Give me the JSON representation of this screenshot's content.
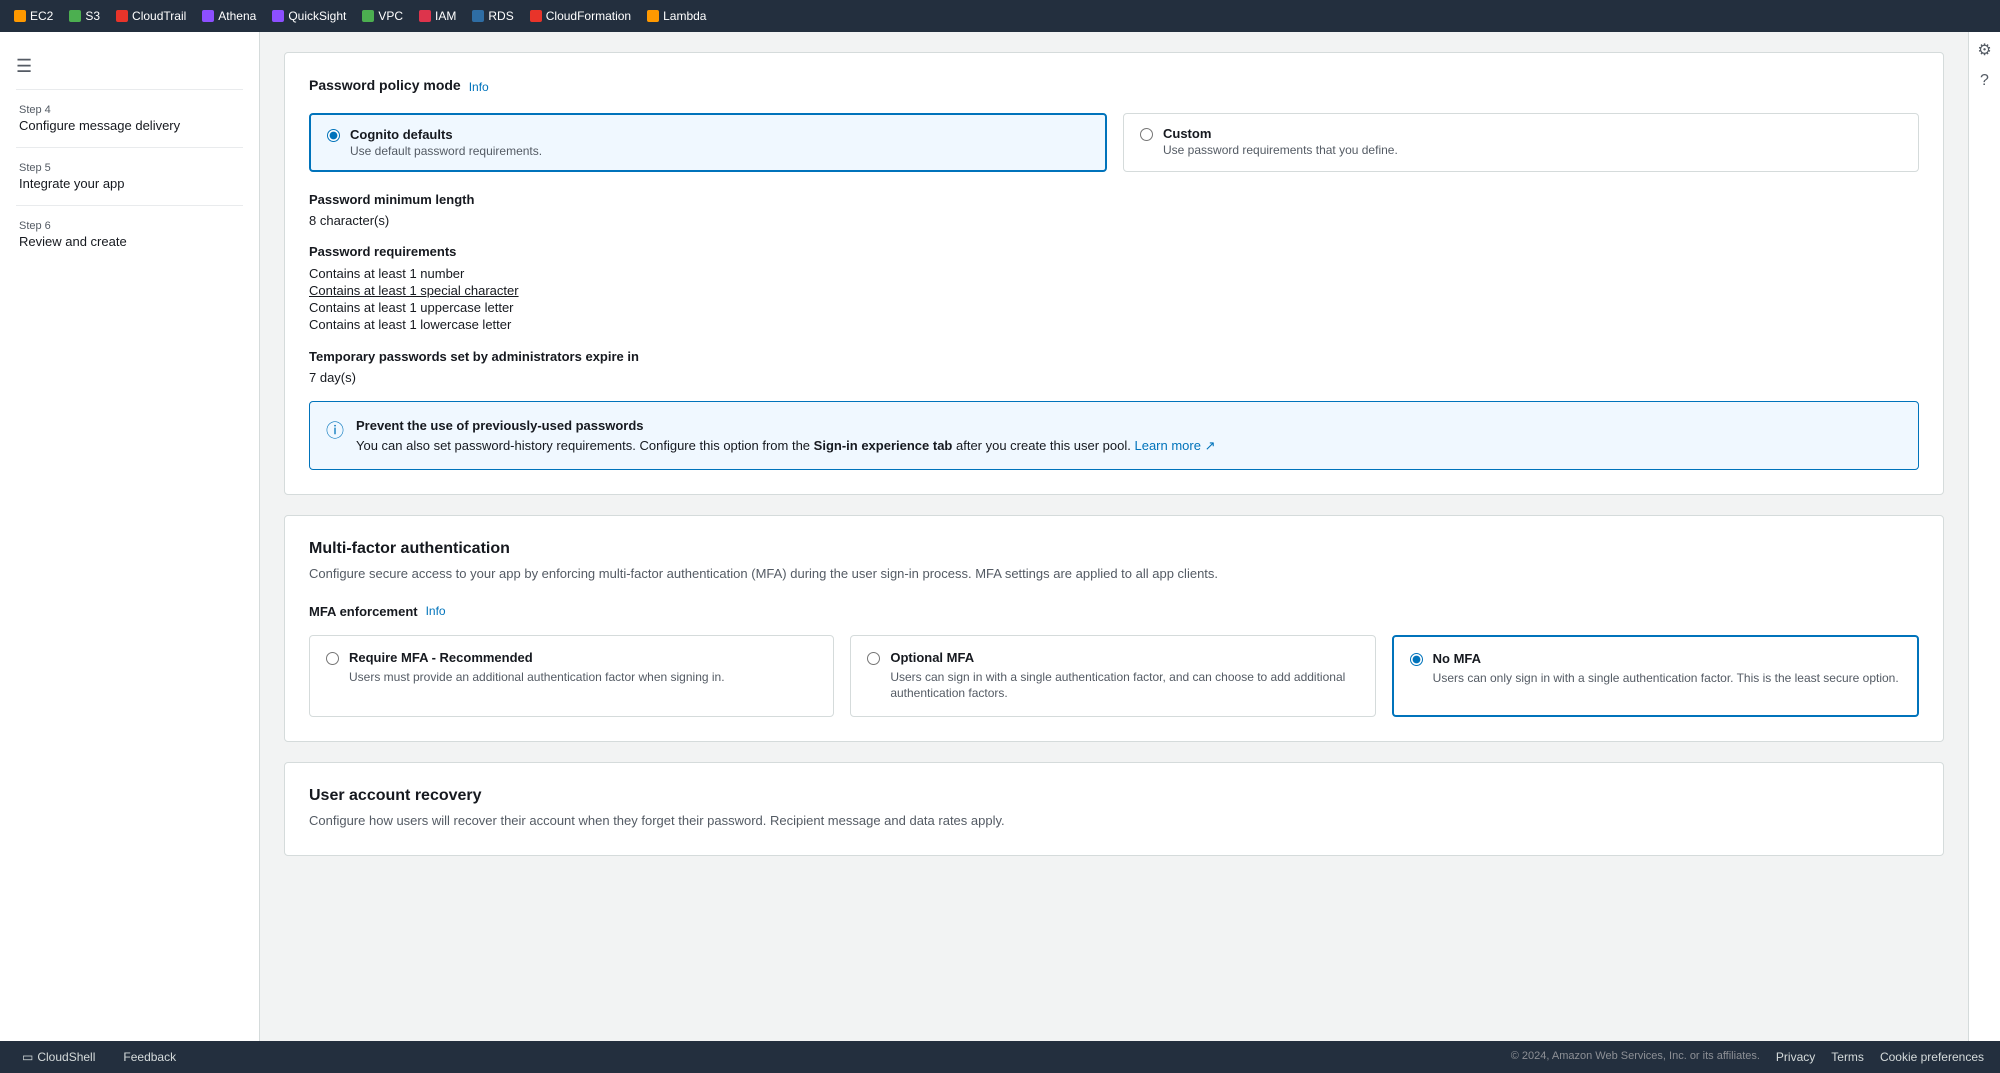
{
  "topnav": {
    "items": [
      {
        "id": "ec2",
        "label": "EC2",
        "color": "#f90",
        "dot_shape": "square"
      },
      {
        "id": "s3",
        "label": "S3",
        "color": "#4CAF50",
        "dot_shape": "square"
      },
      {
        "id": "cloudtrail",
        "label": "CloudTrail",
        "color": "#e8342a",
        "dot_shape": "square"
      },
      {
        "id": "athena",
        "label": "Athena",
        "color": "#8c4fff",
        "dot_shape": "square"
      },
      {
        "id": "quicksight",
        "label": "QuickSight",
        "color": "#8c4fff",
        "dot_shape": "square"
      },
      {
        "id": "vpc",
        "label": "VPC",
        "color": "#4CAF50",
        "dot_shape": "square"
      },
      {
        "id": "iam",
        "label": "IAM",
        "color": "#dd344c",
        "dot_shape": "square"
      },
      {
        "id": "rds",
        "label": "RDS",
        "color": "#2e6da4",
        "dot_shape": "square"
      },
      {
        "id": "cloudformation",
        "label": "CloudFormation",
        "color": "#e8342a",
        "dot_shape": "square"
      },
      {
        "id": "lambda",
        "label": "Lambda",
        "color": "#f90",
        "dot_shape": "square"
      }
    ]
  },
  "sidebar": {
    "steps": [
      {
        "id": "step4",
        "label": "Step 4",
        "title": "Configure message delivery",
        "active": false
      },
      {
        "id": "step5",
        "label": "Step 5",
        "title": "Integrate your app",
        "active": false
      },
      {
        "id": "step6",
        "label": "Step 6",
        "title": "Review and create",
        "active": false
      }
    ]
  },
  "password_policy": {
    "section_title": "Password policy mode",
    "info_label": "Info",
    "mode_cognito": {
      "title": "Cognito defaults",
      "desc": "Use default password requirements.",
      "selected": true
    },
    "mode_custom": {
      "title": "Custom",
      "desc": "Use password requirements that you define.",
      "selected": false
    },
    "min_length_label": "Password minimum length",
    "min_length_value": "8 character(s)",
    "requirements_label": "Password requirements",
    "requirements": [
      {
        "text": "Contains at least 1 number",
        "underlined": false
      },
      {
        "text": "Contains at least 1 special character",
        "underlined": true
      },
      {
        "text": "Contains at least 1 uppercase letter",
        "underlined": false
      },
      {
        "text": "Contains at least 1 lowercase letter",
        "underlined": false
      }
    ],
    "temp_password_label": "Temporary passwords set by administrators expire in",
    "temp_password_value": "7 day(s)",
    "info_box": {
      "title": "Prevent the use of previously-used passwords",
      "body": "You can also set password-history requirements. Configure this option from the",
      "bold_text": "Sign-in experience tab",
      "body2": "after you create this user pool.",
      "link_text": "Learn more",
      "link_symbol": "↗"
    }
  },
  "mfa": {
    "section_title": "Multi-factor authentication",
    "section_desc": "Configure secure access to your app by enforcing multi-factor authentication (MFA) during the user sign-in process. MFA settings are applied to all app clients.",
    "enforcement_label": "MFA enforcement",
    "info_label": "Info",
    "options": [
      {
        "id": "require",
        "title": "Require MFA - Recommended",
        "desc": "Users must provide an additional authentication factor when signing in.",
        "selected": false
      },
      {
        "id": "optional",
        "title": "Optional MFA",
        "desc": "Users can sign in with a single authentication factor, and can choose to add additional authentication factors.",
        "selected": false
      },
      {
        "id": "no_mfa",
        "title": "No MFA",
        "desc": "Users can only sign in with a single authentication factor. This is the least secure option.",
        "selected": true
      }
    ]
  },
  "user_account_recovery": {
    "section_title": "User account recovery",
    "section_desc": "Configure how users will recover their account when they forget their password. Recipient message and data rates apply."
  },
  "footer": {
    "cloudshell_label": "CloudShell",
    "feedback_label": "Feedback",
    "copyright": "© 2024, Amazon Web Services, Inc. or its affiliates.",
    "privacy_label": "Privacy",
    "terms_label": "Terms",
    "cookie_label": "Cookie preferences"
  }
}
